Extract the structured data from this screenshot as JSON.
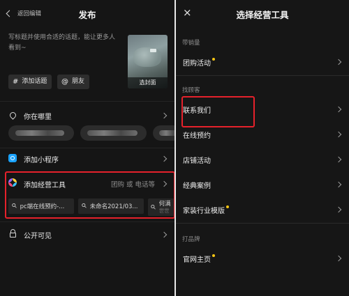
{
  "left": {
    "back_label": "返回编辑",
    "title": "发布",
    "caption_placeholder": "写标题并使用合适的话题，能让更多人看到~",
    "cover_label": "选封面",
    "topic_chip": "添加话题",
    "topic_chip_icon": "#",
    "friend_chip": "朋友",
    "friend_chip_icon": "@",
    "location_label": "你在哪里",
    "mini_program_label": "添加小程序",
    "tools_label": "添加经营工具",
    "tools_hint": "团购 或 电话等",
    "tool_items": [
      "pc端在线预约-...",
      "未命名2021/03...",
      "何满"
    ],
    "tool_item_overflow": "世世",
    "visibility_label": "公开可见"
  },
  "right": {
    "title": "选择经营工具",
    "close_icon": "×",
    "sections": [
      {
        "header": "带销量",
        "items": [
          {
            "label": "团购活动",
            "dot": true
          }
        ]
      },
      {
        "header": "找顾客",
        "items": [
          {
            "label": "联系我们",
            "dot": false
          },
          {
            "label": "在线预约",
            "dot": false
          },
          {
            "label": "店铺活动",
            "dot": false
          },
          {
            "label": "经典案例",
            "dot": false
          },
          {
            "label": "家装行业模版",
            "dot": true
          }
        ]
      },
      {
        "header": "打品牌",
        "items": [
          {
            "label": "官网主页",
            "dot": true
          }
        ]
      }
    ]
  },
  "colors": {
    "background": "#151515",
    "highlight_box": "#e6212b",
    "new_dot": "#f6c515",
    "mini_program": "#1aa3ff"
  }
}
